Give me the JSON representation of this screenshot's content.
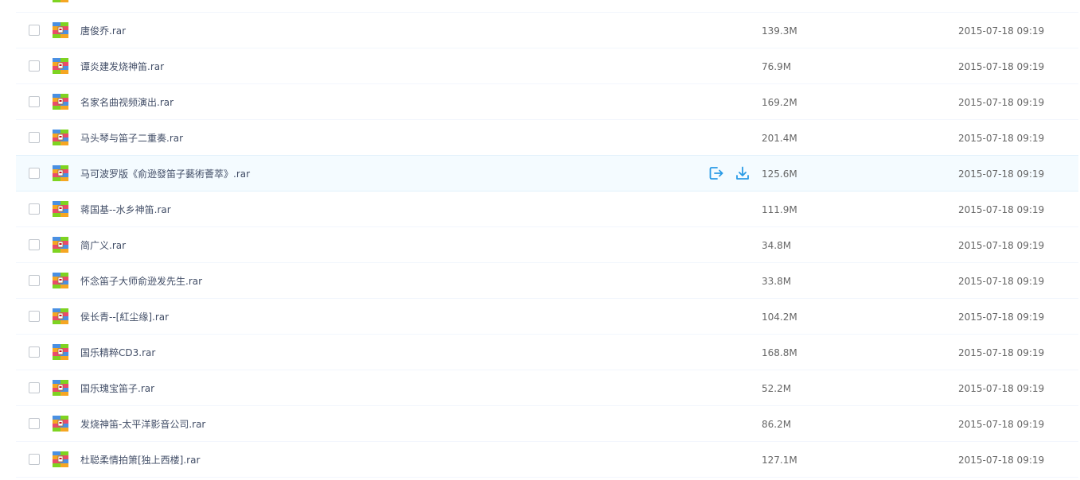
{
  "colors": {
    "accent": "#2a9be6",
    "row_hover": "#f4fbff",
    "row_divider": "#f2f6fd",
    "text": "#424e67"
  },
  "hover_row_index": 5,
  "hover_actions": [
    {
      "icon": "share-icon"
    },
    {
      "icon": "download-icon"
    }
  ],
  "files": [
    {
      "name": "",
      "size": "",
      "date": "",
      "icon": "rar-archive-icon"
    },
    {
      "name": "唐俊乔.rar",
      "size": "139.3M",
      "date": "2015-07-18 09:19",
      "icon": "rar-archive-icon"
    },
    {
      "name": "谭炎建发烧神笛.rar",
      "size": "76.9M",
      "date": "2015-07-18 09:19",
      "icon": "rar-archive-icon"
    },
    {
      "name": "名家名曲视频演出.rar",
      "size": "169.2M",
      "date": "2015-07-18 09:19",
      "icon": "rar-archive-icon"
    },
    {
      "name": "马头琴与笛子二重奏.rar",
      "size": "201.4M",
      "date": "2015-07-18 09:19",
      "icon": "rar-archive-icon"
    },
    {
      "name": "马可波罗版《俞逊發笛子藝術薈萃》.rar",
      "size": "125.6M",
      "date": "2015-07-18 09:19",
      "icon": "rar-archive-icon"
    },
    {
      "name": "蒋国基--水乡神笛.rar",
      "size": "111.9M",
      "date": "2015-07-18 09:19",
      "icon": "rar-archive-icon"
    },
    {
      "name": "简广义.rar",
      "size": "34.8M",
      "date": "2015-07-18 09:19",
      "icon": "rar-archive-icon"
    },
    {
      "name": "怀念笛子大师俞逊发先生.rar",
      "size": "33.8M",
      "date": "2015-07-18 09:19",
      "icon": "rar-archive-icon"
    },
    {
      "name": "侯长青--[紅尘缘].rar",
      "size": "104.2M",
      "date": "2015-07-18 09:19",
      "icon": "rar-archive-icon"
    },
    {
      "name": "国乐精粹CD3.rar",
      "size": "168.8M",
      "date": "2015-07-18 09:19",
      "icon": "rar-archive-icon"
    },
    {
      "name": "国乐瑰宝笛子.rar",
      "size": "52.2M",
      "date": "2015-07-18 09:19",
      "icon": "rar-archive-icon"
    },
    {
      "name": "发烧神笛-太平洋影音公司.rar",
      "size": "86.2M",
      "date": "2015-07-18 09:19",
      "icon": "rar-archive-icon"
    },
    {
      "name": "杜聪柔情拍箫[独上西楼].rar",
      "size": "127.1M",
      "date": "2015-07-18 09:19",
      "icon": "rar-archive-icon"
    }
  ]
}
